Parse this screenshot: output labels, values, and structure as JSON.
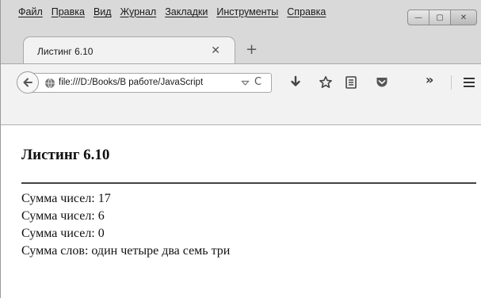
{
  "menu": {
    "items": [
      "Файл",
      "Правка",
      "Вид",
      "Журнал",
      "Закладки",
      "Инструменты",
      "Справка"
    ]
  },
  "window_controls": {
    "minimize": "—",
    "maximize": "▢",
    "close": "✕"
  },
  "tab": {
    "title": "Листинг 6.10",
    "close_glyph": "✕",
    "new_tab_glyph": "+"
  },
  "navbar": {
    "url": "file:///D:/Books/В работе/JavaScript",
    "reload_glyph": "C",
    "overflow_glyph": "»",
    "icons": [
      "back-arrow-icon",
      "globe-icon",
      "dropdown-icon",
      "reload-icon",
      "download-icon",
      "bookmark-star-icon",
      "reading-list-icon",
      "pocket-icon",
      "overflow-icon",
      "hamburger-menu-icon"
    ]
  },
  "page": {
    "heading": "Листинг 6.10",
    "lines": [
      "Сумма чисел: 17",
      "Сумма чисел: 6",
      "Сумма чисел: 0",
      "Сумма слов: один четыре два семь три"
    ]
  }
}
